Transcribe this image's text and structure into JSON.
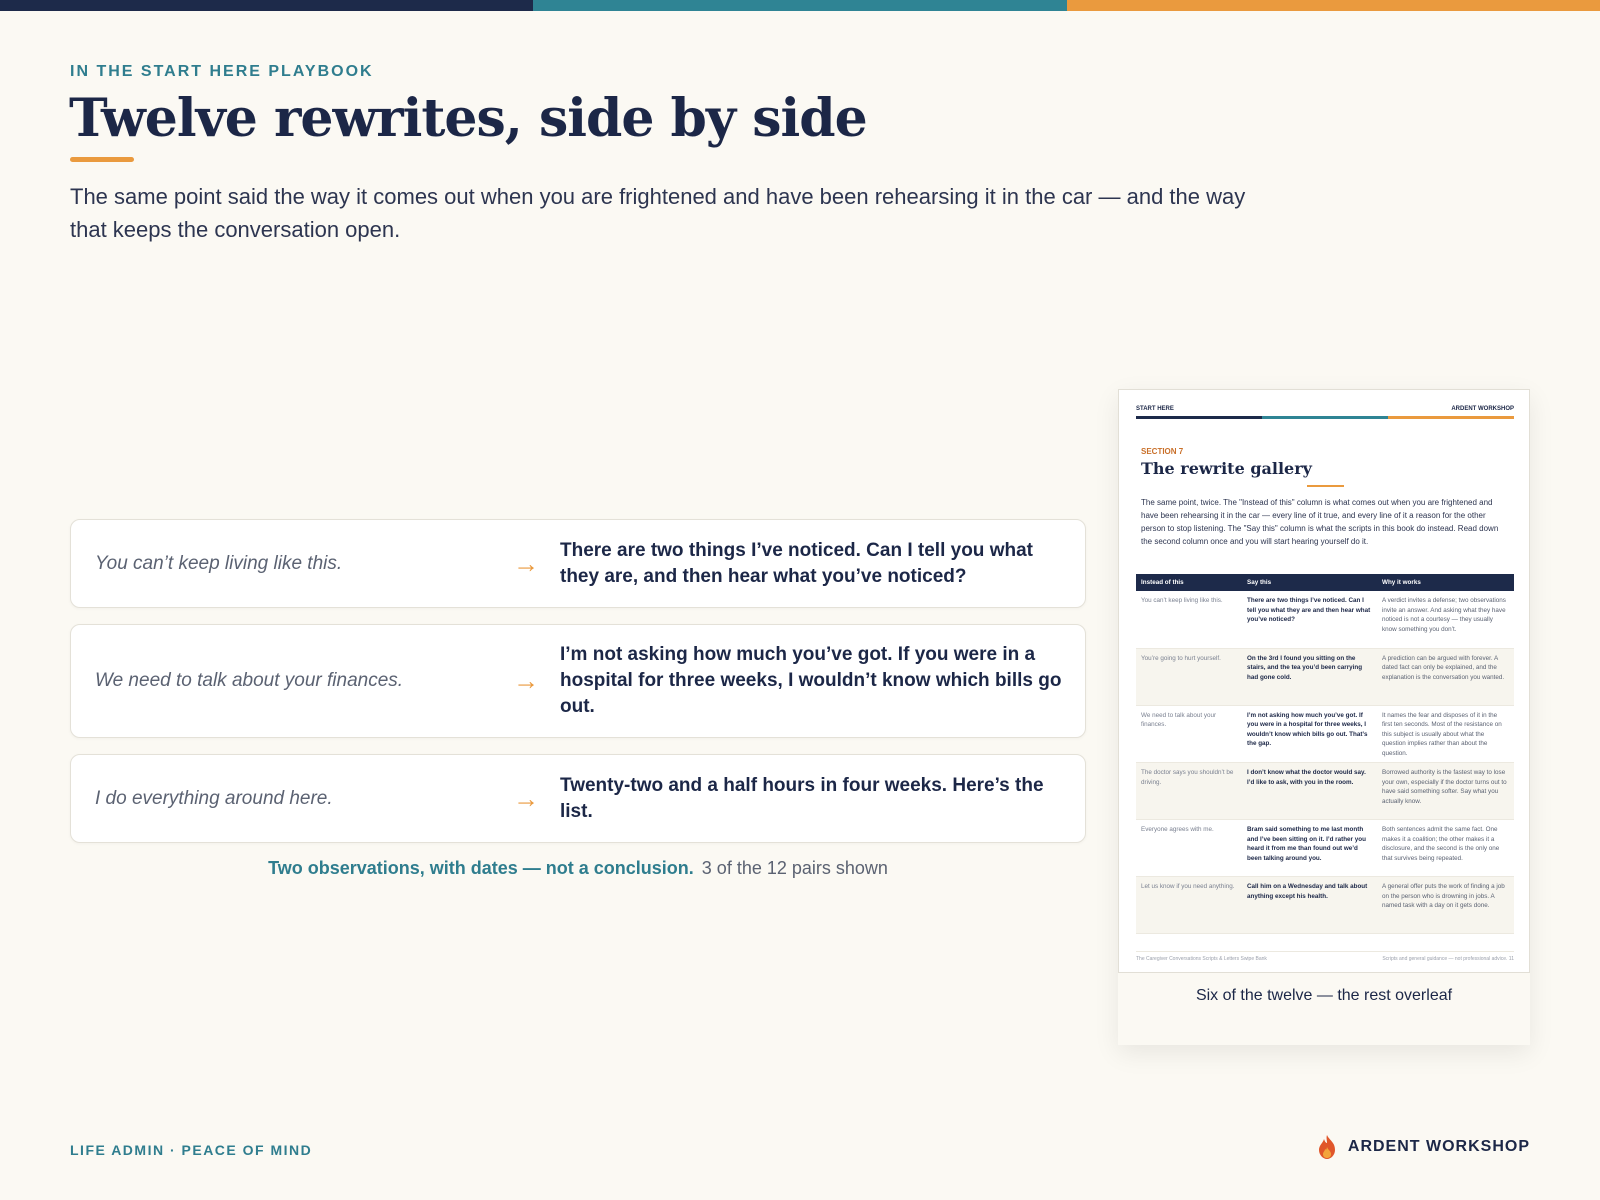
{
  "colors": {
    "navy": "#1d2a4a",
    "teal": "#2f8494",
    "orange": "#ea9a3e",
    "background": "#fbf9f3"
  },
  "eyebrow": "IN THE START HERE PLAYBOOK",
  "title": "Twelve rewrites, side by side",
  "lede": "The same point said the way it comes out when you are frightened and have been rehearsing it in the car — and the way that keeps the conversation open.",
  "pairs": [
    {
      "before": "You can’t keep living like this.",
      "arrow": "→",
      "after": "There are two things I’ve noticed. Can I tell you what they are, and then hear what you’ve noticed?"
    },
    {
      "before": "We need to talk about your finances.",
      "arrow": "→",
      "after": "I’m not asking how much you’ve got. If you were in a hospital for three weeks, I wouldn’t know which bills go out."
    },
    {
      "before": "I do everything around here.",
      "arrow": "→",
      "after": "Twenty-two and a half hours in four weeks. Here’s the list."
    }
  ],
  "caption": {
    "highlight": "Two observations, with dates — not a conclusion.",
    "count": "3 of the 12 pairs shown"
  },
  "preview": {
    "header_left": "START HERE",
    "header_right": "ARDENT WORKSHOP",
    "section": "SECTION 7",
    "title": "The rewrite gallery",
    "intro": "The same point, twice. The \"Instead of this\" column is what comes out when you are frightened and have been rehearsing it in the car — every line of it true, and every line of it a reason for the other person to stop listening. The \"Say this\" column is what the scripts in this book do instead. Read down the second column once and you will start hearing yourself do it.",
    "columns": [
      "Instead of this",
      "Say this",
      "Why it works"
    ],
    "rows": [
      [
        "You can’t keep living like this.",
        "There are two things I’ve noticed. Can I tell you what they are and then hear what you’ve noticed?",
        "A verdict invites a defense; two observations invite an answer. And asking what they have noticed is not a courtesy — they usually know something you don’t."
      ],
      [
        "You’re going to hurt yourself.",
        "On the 3rd I found you sitting on the stairs, and the tea you’d been carrying had gone cold.",
        "A prediction can be argued with forever. A dated fact can only be explained, and the explanation is the conversation you wanted."
      ],
      [
        "We need to talk about your finances.",
        "I’m not asking how much you’ve got. If you were in a hospital for three weeks, I wouldn’t know which bills go out. That’s the gap.",
        "It names the fear and disposes of it in the first ten seconds. Most of the resistance on this subject is usually about what the question implies rather than about the question."
      ],
      [
        "The doctor says you shouldn’t be driving.",
        "I don’t know what the doctor would say. I’d like to ask, with you in the room.",
        "Borrowed authority is the fastest way to lose your own, especially if the doctor turns out to have said something softer. Say what you actually know."
      ],
      [
        "Everyone agrees with me.",
        "Bram said something to me last month and I’ve been sitting on it. I’d rather you heard it from me than found out we’d been talking around you.",
        "Both sentences admit the same fact. One makes it a coalition; the other makes it a disclosure, and the second is the only one that survives being repeated."
      ],
      [
        "Let us know if you need anything.",
        "Call him on a Wednesday and talk about anything except his health.",
        "A general offer puts the work of finding a job on the person who is drowning in jobs. A named task with a day on it gets done."
      ]
    ],
    "footer_left": "The Caregiver Conversations Scripts & Letters Swipe Bank",
    "footer_right": "Scripts and general guidance — not professional advice.   11",
    "caption": "Six of the twelve — the rest overleaf"
  },
  "footer": {
    "left": "LIFE ADMIN · PEACE OF MIND",
    "brand": "ARDENT WORKSHOP",
    "logo_icon": "flame-icon"
  }
}
